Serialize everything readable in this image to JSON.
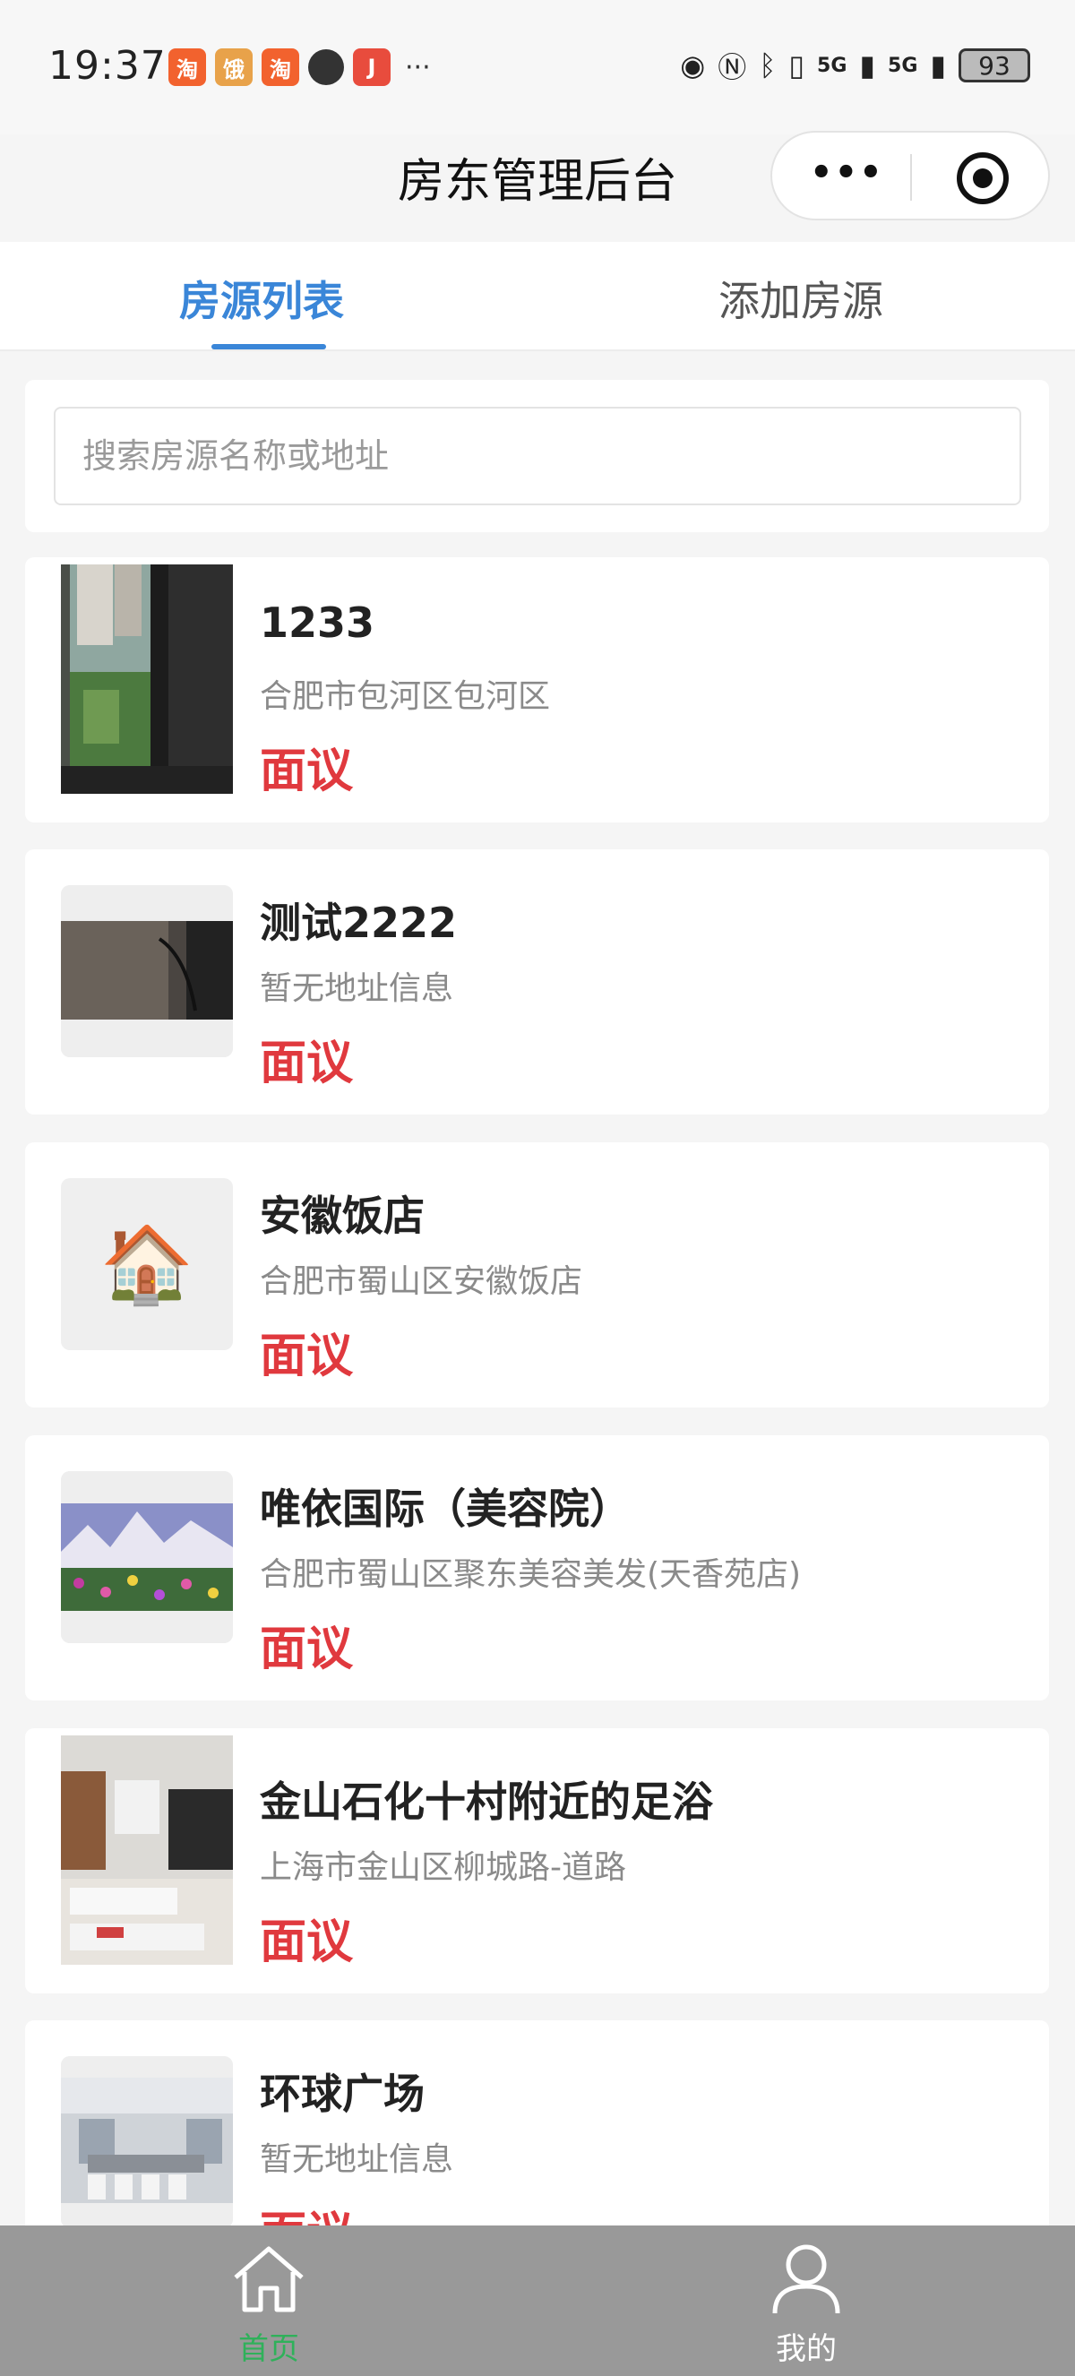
{
  "status_bar": {
    "time": "19:37",
    "battery": "93",
    "signal_1": "5G",
    "signal_2": "5G",
    "notifications": [
      "taobao-icon",
      "eleme-icon",
      "taobao-icon",
      "chat-icon",
      "syjob-icon"
    ],
    "more": "···"
  },
  "header": {
    "title": "房东管理后台",
    "menu_dots": "•••"
  },
  "tabs": [
    {
      "label": "房源列表",
      "active": true
    },
    {
      "label": "添加房源",
      "active": false
    }
  ],
  "search": {
    "placeholder": "搜索房源名称或地址"
  },
  "listings": [
    {
      "title": "1233",
      "address": "合肥市包河区包河区",
      "price": "面议",
      "thumb": "window-photo"
    },
    {
      "title": "测试2222",
      "address": "暂无地址信息",
      "price": "面议",
      "thumb": "dark-room-photo"
    },
    {
      "title": "安徽饭店",
      "address": "合肥市蜀山区安徽饭店",
      "price": "面议",
      "thumb": "house-emoji",
      "emoji": "🏠"
    },
    {
      "title": "唯依国际（美容院）",
      "address": "合肥市蜀山区聚东美容美发(天香苑店)",
      "price": "面议",
      "thumb": "landscape-photo"
    },
    {
      "title": "金山石化十村附近的足浴",
      "address": "上海市金山区柳城路-道路",
      "price": "面议",
      "thumb": "spa-room-photo"
    },
    {
      "title": "环球广场",
      "address": "暂无地址信息",
      "price": "面议",
      "thumb": "office-room-photo"
    }
  ],
  "bottom_nav": [
    {
      "label": "首页",
      "icon": "home-icon",
      "active": true
    },
    {
      "label": "我的",
      "icon": "user-icon",
      "active": false
    }
  ],
  "colors": {
    "accent": "#3a86d8",
    "price": "#e0393e",
    "nav_active": "#2fb15a"
  }
}
